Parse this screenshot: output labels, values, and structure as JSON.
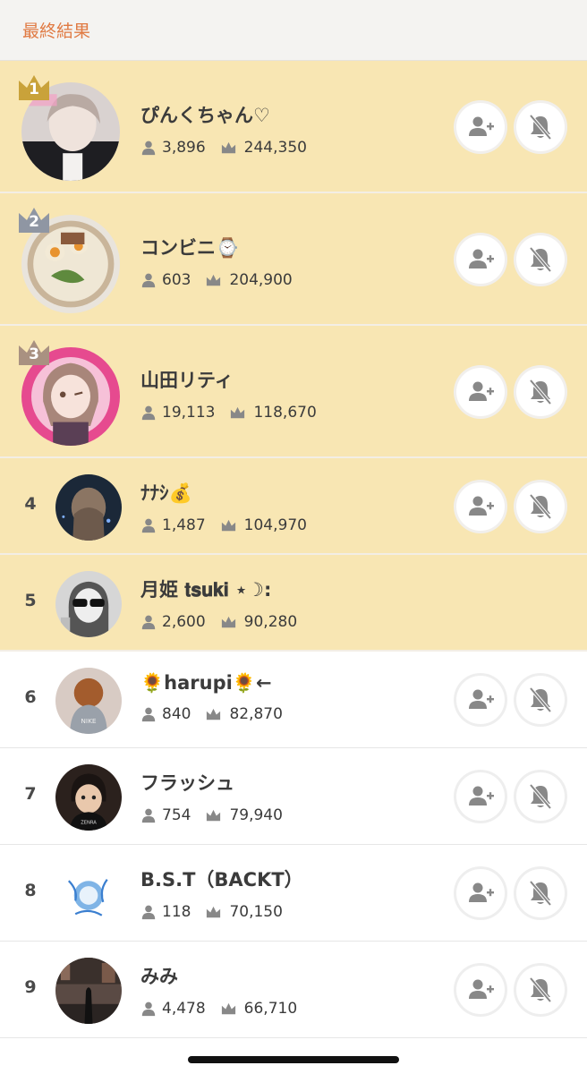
{
  "header": {
    "title": "最終結果"
  },
  "colors": {
    "accent": "#e07a43",
    "highlight": "#f8e6b3",
    "gold": "#c9a23a",
    "silver": "#8f96a3",
    "bronze": "#a99181",
    "icon_gray": "#888888"
  },
  "icons": {
    "followers": "person-icon",
    "score": "crown-icon",
    "follow": "add-user-icon",
    "notify": "bell-off-icon"
  },
  "ranking": [
    {
      "rank": "1",
      "name": "ぴんくちゃん♡",
      "followers": "3,896",
      "score": "244,350"
    },
    {
      "rank": "2",
      "name": "コンビニ⌚",
      "followers": "603",
      "score": "204,900"
    },
    {
      "rank": "3",
      "name": "山田リティ",
      "followers": "19,113",
      "score": "118,670"
    },
    {
      "rank": "4",
      "name": "ﾅﾅｼ💰",
      "followers": "1,487",
      "score": "104,970"
    },
    {
      "rank": "5",
      "name": "月姫 𝐭𝐬𝐮𝐤𝐢 ⋆☽︎:",
      "followers": "2,600",
      "score": "90,280"
    },
    {
      "rank": "6",
      "name": "🌻harupi🌻←",
      "followers": "840",
      "score": "82,870"
    },
    {
      "rank": "7",
      "name": "フラッシュ",
      "followers": "754",
      "score": "79,940"
    },
    {
      "rank": "8",
      "name": "B.S.T（BACKT）",
      "followers": "118",
      "score": "70,150"
    },
    {
      "rank": "9",
      "name": "みみ",
      "followers": "4,478",
      "score": "66,710"
    }
  ]
}
